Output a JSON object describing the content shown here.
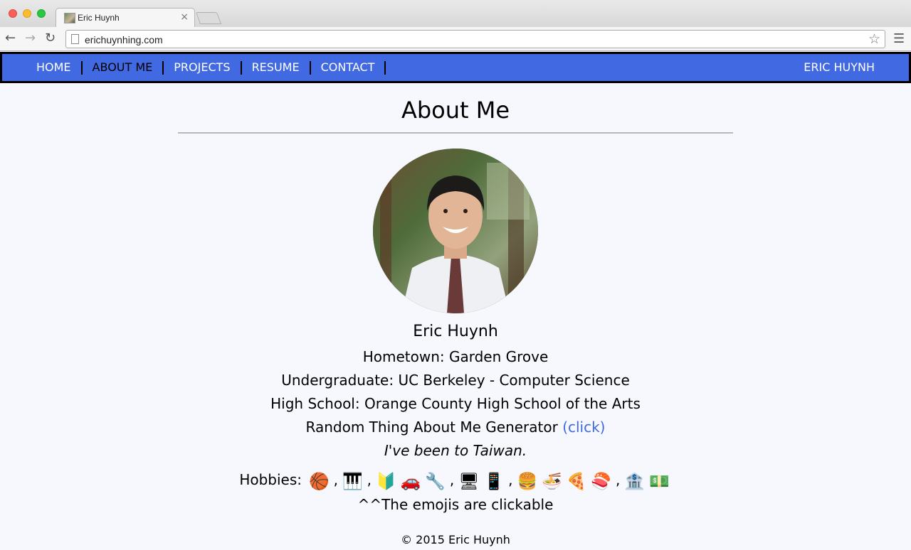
{
  "browser": {
    "tab_title": "Eric Huynh",
    "tab_close": "×",
    "url": "erichuynhing.com",
    "icons": {
      "back": "back-arrow-icon",
      "forward": "forward-arrow-icon",
      "reload": "reload-icon",
      "bookmark": "star-icon",
      "menu": "hamburger-menu-icon"
    }
  },
  "nav": {
    "links": [
      {
        "label": "HOME"
      },
      {
        "label": "ABOUT ME"
      },
      {
        "label": "PROJECTS"
      },
      {
        "label": "RESUME"
      },
      {
        "label": "CONTACT"
      }
    ],
    "brand": "ERIC HUYNH",
    "colors": {
      "background": "#4169e1",
      "active": "#000000",
      "link": "#ffffff"
    }
  },
  "main": {
    "title": "About Me",
    "name": "Eric Huynh",
    "hometown": "Hometown: Garden Grove",
    "undergrad": "Undergraduate: UC Berkeley - Computer Science",
    "highschool": "High School: Orange County High School of the Arts",
    "random_label": "Random Thing About Me Generator ",
    "random_link": "(click)",
    "random_fact": "I've been to Taiwan.",
    "hobbies_label": "Hobbies:",
    "hobbies": {
      "group1": [
        "🏀"
      ],
      "group2": [
        "🎹"
      ],
      "group3": [
        "🔰",
        "🚗",
        "🔧"
      ],
      "group4": [
        "🖥",
        "📱"
      ],
      "group5": [
        "🍔",
        "🍜",
        "🍕",
        "🍣"
      ],
      "group6": [
        "🏦",
        "💵"
      ]
    },
    "comma": ",",
    "emoji_note": "^^The emojis are clickable",
    "footer": "© 2015 Eric Huynh"
  }
}
